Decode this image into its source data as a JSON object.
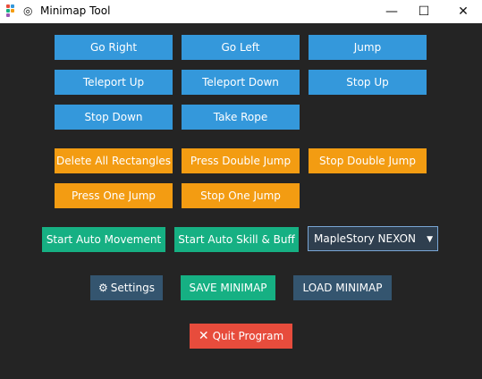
{
  "window": {
    "title": "Minimap Tool",
    "controls": {
      "minimize": "—",
      "maximize": "☐",
      "close": "✕"
    }
  },
  "movement_buttons": {
    "go_right": "Go Right",
    "go_left": "Go Left",
    "jump": "Jump",
    "teleport_up": "Teleport Up",
    "teleport_down": "Teleport Down",
    "stop_up": "Stop Up",
    "stop_down": "Stop Down",
    "take_rope": "Take Rope"
  },
  "editing_buttons": {
    "delete_all_rectangles": "Delete All Rectangles",
    "press_double_jump": "Press Double Jump",
    "stop_double_jump": "Stop Double Jump",
    "press_one_jump": "Press One Jump",
    "stop_one_jump": "Stop One Jump"
  },
  "auto_buttons": {
    "start_auto_movement": "Start Auto Movement",
    "start_auto_skill_buff": "Start Auto Skill & Buff"
  },
  "game_select": {
    "selected": "MapleStory NEXON"
  },
  "bottom_buttons": {
    "settings": "Settings",
    "save_minimap": "SAVE MINIMAP",
    "load_minimap": "LOAD MINIMAP",
    "quit_program": "Quit Program"
  },
  "icons": {
    "app": "app-grid-icon",
    "tool": "target-icon",
    "settings": "gear-icon",
    "quit": "close-x-icon"
  },
  "colors": {
    "blue": "#3498db",
    "orange": "#f39c12",
    "green": "#16b083",
    "slate": "#34556f",
    "red": "#e74c3c",
    "background": "#242424"
  }
}
